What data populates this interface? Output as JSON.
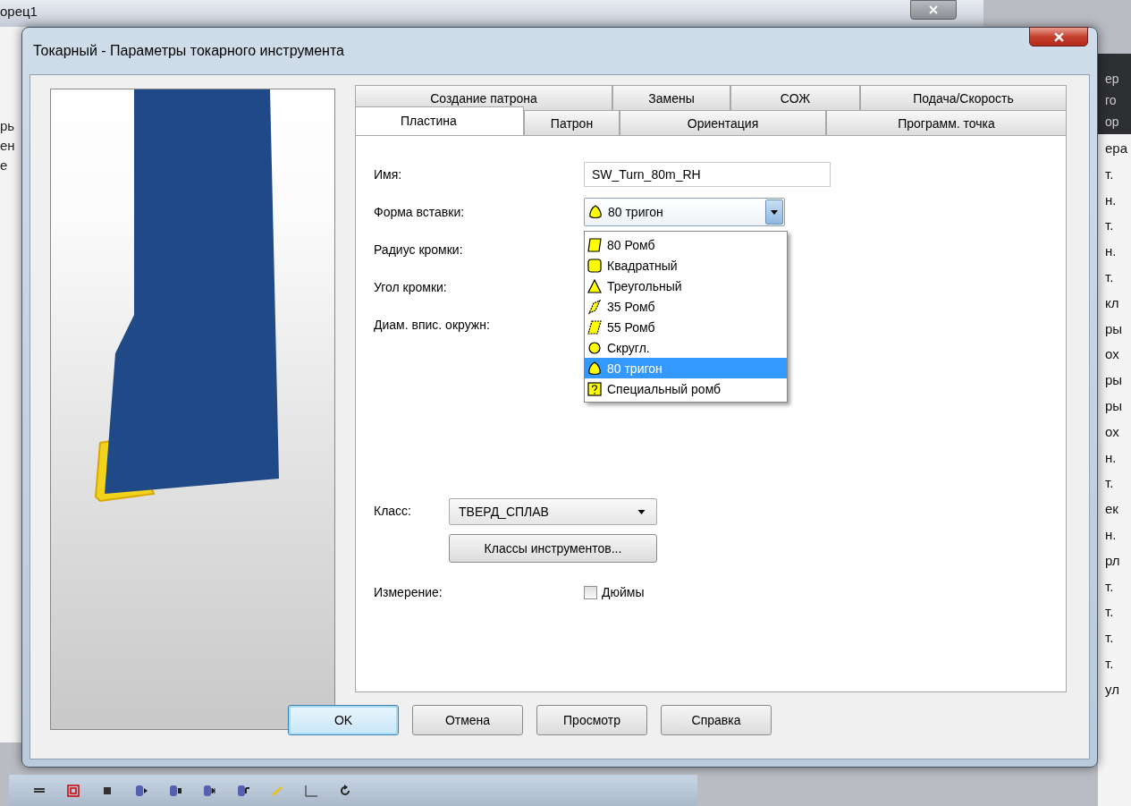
{
  "background": {
    "window_title": "орец1",
    "left_fragments": [
      "рь",
      "ен",
      "е"
    ],
    "right_header_fragments": [
      "ер",
      "го",
      "ор"
    ],
    "right_fragments": [
      "ера",
      "т.",
      "н.",
      "т.",
      "н.",
      "т.",
      "кл",
      "ры",
      "ох",
      "ры",
      "ры",
      "ох",
      "н.",
      "т.",
      "ек",
      "н.",
      "рл",
      "т.",
      "т.",
      "т.",
      "т.",
      "ул"
    ]
  },
  "dialog": {
    "title": "Токарный - Параметры токарного инструмента",
    "tab_rows": [
      [
        {
          "label": "Создание патрона",
          "selected": false
        },
        {
          "label": "Замены",
          "selected": false
        },
        {
          "label": "СОЖ",
          "selected": false
        },
        {
          "label": "Подача/Скорость",
          "selected": false
        }
      ],
      [
        {
          "label": "Пластина",
          "selected": true
        },
        {
          "label": "Патрон",
          "selected": false
        },
        {
          "label": "Ориентация",
          "selected": false
        },
        {
          "label": "Программ. точка",
          "selected": false
        }
      ]
    ],
    "name_label": "Имя:",
    "name_value": "SW_Turn_80m_RH",
    "shape_label": "Форма вставки:",
    "shape_value": {
      "label": "80 тригон",
      "kind": "trigon"
    },
    "shape_options": [
      {
        "label": "80 Ромб",
        "kind": "rhombus80",
        "selected": false
      },
      {
        "label": "Квадратный",
        "kind": "square",
        "selected": false
      },
      {
        "label": "Треугольный",
        "kind": "triangle",
        "selected": false
      },
      {
        "label": "35 Ромб",
        "kind": "rhombus35",
        "selected": false
      },
      {
        "label": "55 Ромб",
        "kind": "rhombus55",
        "selected": false
      },
      {
        "label": "Скругл.",
        "kind": "round",
        "selected": false
      },
      {
        "label": "80 тригон",
        "kind": "trigon",
        "selected": true
      },
      {
        "label": "Специальный ромб",
        "kind": "special",
        "selected": false
      }
    ],
    "radius_label": "Радиус кромки:",
    "angle_label": "Угол кромки:",
    "diameter_label": "Диам. впис. окружн:",
    "class_label": "Класс:",
    "class_value": "ТВЕРД_СПЛАВ",
    "tool_classes_button": "Классы инструментов...",
    "measure_label": "Измерение:",
    "inches": {
      "label": "Дюймы",
      "checked": false
    },
    "buttons": [
      {
        "label": "OK",
        "default": true
      },
      {
        "label": "Отмена",
        "default": false
      },
      {
        "label": "Просмотр",
        "default": false
      },
      {
        "label": "Справка",
        "default": false
      }
    ]
  }
}
